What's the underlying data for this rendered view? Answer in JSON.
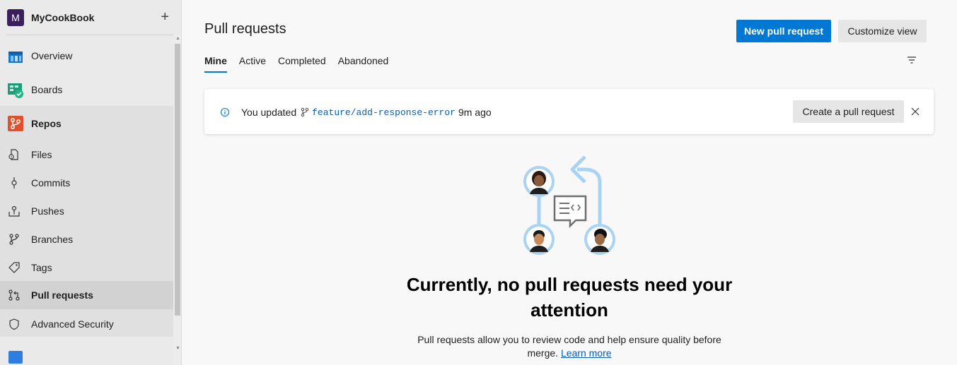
{
  "project": {
    "initial": "M",
    "name": "MyCookBook",
    "add_label": "+"
  },
  "nav": {
    "overview": "Overview",
    "boards": "Boards",
    "repos": "Repos",
    "files": "Files",
    "commits": "Commits",
    "pushes": "Pushes",
    "branches": "Branches",
    "tags": "Tags",
    "pull_requests": "Pull requests",
    "advanced_security": "Advanced Security"
  },
  "header": {
    "title": "Pull requests",
    "new_pr": "New pull request",
    "customize": "Customize view"
  },
  "tabs": [
    "Mine",
    "Active",
    "Completed",
    "Abandoned"
  ],
  "banner": {
    "prefix": "You updated",
    "branch": "feature/add-response-error",
    "time": "9m ago",
    "action": "Create a pull request"
  },
  "empty": {
    "title": "Currently, no pull requests need your attention",
    "desc": "Pull requests allow you to review code and help ensure quality before merge.",
    "link": "Learn more"
  },
  "colors": {
    "accent": "#0078d4",
    "link": "#0b5cad",
    "project_avatar": "#3b1f5c"
  }
}
